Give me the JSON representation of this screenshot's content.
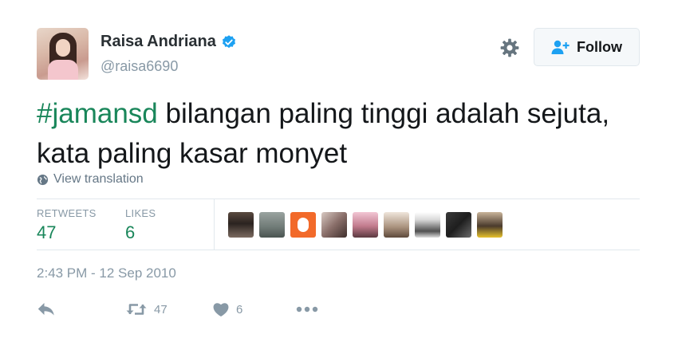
{
  "user": {
    "name": "Raisa Andriana",
    "handle": "@raisa6690",
    "verified": true
  },
  "follow_button": {
    "label": "Follow"
  },
  "tweet": {
    "hashtag": "#jamansd",
    "text": " bilangan paling tinggi adalah sejuta, kata paling kasar monyet"
  },
  "translation_link": "View translation",
  "stats": {
    "retweets_label": "RETWEETS",
    "retweets_value": "47",
    "likes_label": "LIKES",
    "likes_value": "6"
  },
  "timestamp": "2:43 PM - 12 Sep 2010",
  "actions": {
    "retweet_count": "47",
    "like_count": "6"
  },
  "colors": {
    "hashtag": "#19865a",
    "stat_value": "#19865a",
    "muted": "#8899a6",
    "verified": "#1da1f2",
    "follow_icon": "#1da1f2"
  },
  "icons": [
    "verified-badge-icon",
    "gear-icon",
    "follow-user-icon",
    "globe-icon",
    "reply-icon",
    "retweet-icon",
    "heart-icon",
    "more-icon"
  ]
}
